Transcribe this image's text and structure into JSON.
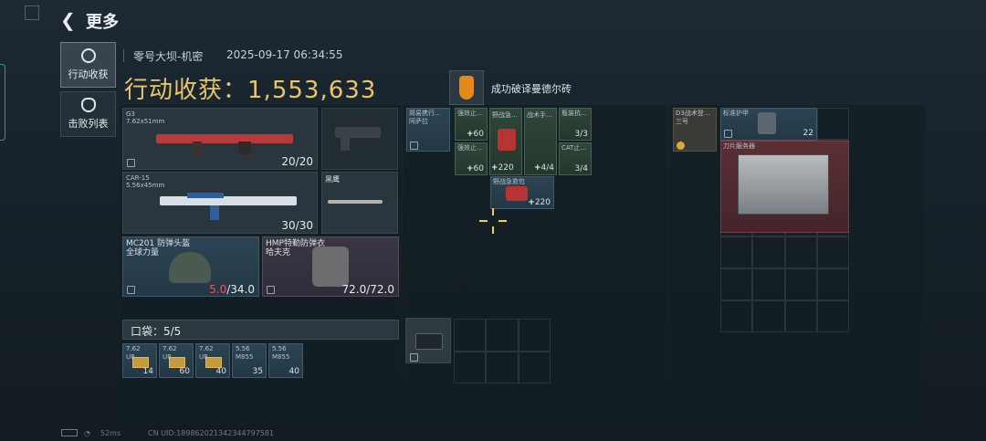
{
  "nav": {
    "back_icon": "back-arrow-icon",
    "title": "更多"
  },
  "side_tabs": [
    {
      "label": "行动收获",
      "icon": "target-icon"
    },
    {
      "label": "击败列表",
      "icon": "skull-icon"
    }
  ],
  "header": {
    "map": "零号大坝-机密",
    "datetime": "2025-09-17 06:34:55",
    "gain_label": "行动收获：",
    "gain_value": "1,553,633",
    "achievement": "成功破译曼德尔砖"
  },
  "loadout": {
    "weapon1": {
      "name": "G3",
      "caliber": "7.62x51mm",
      "ammo": "20/20"
    },
    "weapon2": {
      "name": "CAR-15",
      "caliber": "5.56x45mm",
      "ammo": "30/30"
    },
    "melee": {
      "name": "黑鹰"
    },
    "helmet": {
      "name": "MC201 防弹头盔",
      "maker": "全球力量",
      "durability": "5.0",
      "max": "/34.0"
    },
    "armor": {
      "name": "HMP特勤防弹衣",
      "maker": "哈夫克",
      "durability": "72.0/72.0"
    }
  },
  "pockets": {
    "label": "口袋：5/5",
    "items": [
      {
        "cal": "7.62",
        "type": "UR",
        "count": "14"
      },
      {
        "cal": "7.62",
        "type": "UR",
        "count": "60"
      },
      {
        "cal": "7.62",
        "type": "UR",
        "count": "40"
      },
      {
        "cal": "5.56",
        "type": "M855",
        "count": "35"
      },
      {
        "cal": "5.56",
        "type": "M855",
        "count": "40"
      }
    ]
  },
  "rig": {
    "items": [
      {
        "name": "简易携行…",
        "sub": "阿萨拉"
      },
      {
        "name": "强效止…",
        "count": "60"
      },
      {
        "name": "强效止…",
        "count": "60"
      },
      {
        "name": "野战急…",
        "count": "220"
      },
      {
        "name": "战术手…",
        "count": "4/4"
      },
      {
        "name": "瓶装抗…",
        "count": "3/3"
      },
      {
        "name": "CAT止…",
        "count": "3/4"
      },
      {
        "name": "野战急救包",
        "count": "220"
      }
    ]
  },
  "backpack": {
    "bag": {
      "name": "D3战术登…",
      "sub": "三号"
    },
    "armor_plate": {
      "name": "标准护甲",
      "count": "22"
    },
    "server": {
      "name": "刀片服务器"
    }
  },
  "footer": {
    "ping": "52ms",
    "uid": "CN UID:18986202134234479758‌1"
  },
  "colors": {
    "gold": "#e9c46a",
    "red_value": "#e2595a",
    "crosshair": "#f2d230"
  }
}
